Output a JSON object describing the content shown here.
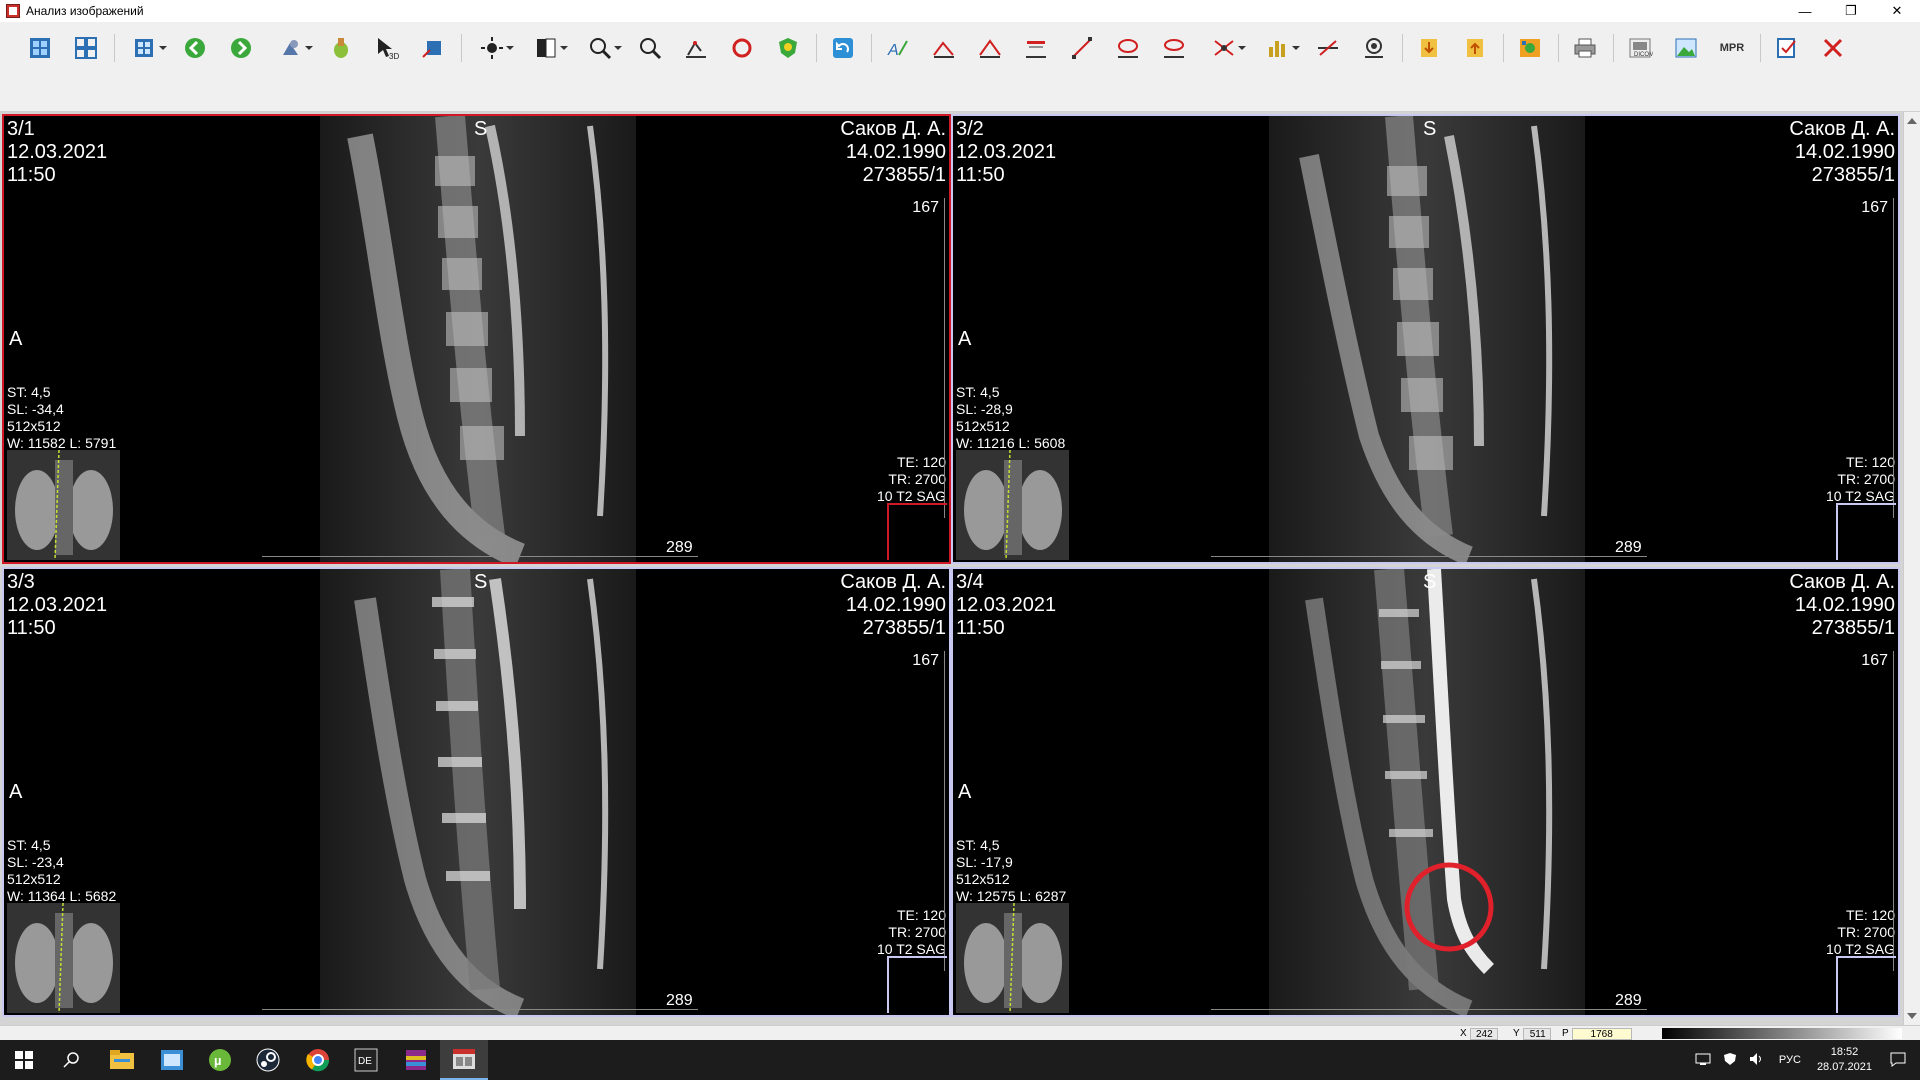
{
  "window": {
    "title": "Анализ изображений",
    "controls": [
      "minimize-icon",
      "restore-icon",
      "close-icon"
    ]
  },
  "toolbar": {
    "mpr_label": "MPR",
    "buttons": [
      "view-grid-icon",
      "layout-icon",
      "series-layout-icon",
      "back-icon",
      "forward-icon",
      "tools-icon",
      "hand-icon",
      "pointer-3d-icon",
      "sync-icon",
      "brightness-icon",
      "window-level-icon",
      "zoom-icon",
      "magnifier-icon",
      "roi-icon",
      "rotate-icon",
      "shield-icon",
      "undo-icon",
      "annotation-icon",
      "ruler-icon",
      "angle-icon",
      "cobb-icon",
      "line-icon",
      "ellipse-roi-icon",
      "profile-icon",
      "markers-icon",
      "histogram-icon",
      "cut-icon",
      "settings-eye-icon",
      "export-icon",
      "import-icon",
      "film-icon",
      "print-icon",
      "dicom-icon",
      "picture-icon",
      "mpr-button",
      "report-icon",
      "close-icon"
    ]
  },
  "panes": [
    {
      "id": "3/1",
      "date": "12.03.2021",
      "time": "11:50",
      "patient": "Саков Д. А.",
      "dob": "14.02.1990",
      "study": "273855/1",
      "scale_top": "167",
      "orient_top": "S",
      "orient_left": "A",
      "st": "ST: 4,5",
      "sl": "SL: -34,4",
      "matrix": "512x512",
      "wl": "W: 11582 L: 5791",
      "te": "TE: 120",
      "tr": "TR: 2700",
      "series": "10 T2 SAG",
      "scale_bottom": "289",
      "active": true
    },
    {
      "id": "3/2",
      "date": "12.03.2021",
      "time": "11:50",
      "patient": "Саков Д. А.",
      "dob": "14.02.1990",
      "study": "273855/1",
      "scale_top": "167",
      "orient_top": "S",
      "orient_left": "A",
      "st": "ST: 4,5",
      "sl": "SL: -28,9",
      "matrix": "512x512",
      "wl": "W: 11216 L: 5608",
      "te": "TE: 120",
      "tr": "TR: 2700",
      "series": "10 T2 SAG",
      "scale_bottom": "289",
      "active": false
    },
    {
      "id": "3/3",
      "date": "12.03.2021",
      "time": "11:50",
      "patient": "Саков Д. А.",
      "dob": "14.02.1990",
      "study": "273855/1",
      "scale_top": "167",
      "orient_top": "S",
      "orient_left": "A",
      "st": "ST: 4,5",
      "sl": "SL: -23,4",
      "matrix": "512x512",
      "wl": "W: 11364 L: 5682",
      "te": "TE: 120",
      "tr": "TR: 2700",
      "series": "10 T2 SAG",
      "scale_bottom": "289",
      "active": false
    },
    {
      "id": "3/4",
      "date": "12.03.2021",
      "time": "11:50",
      "patient": "Саков Д. А.",
      "dob": "14.02.1990",
      "study": "273855/1",
      "scale_top": "167",
      "orient_top": "S",
      "orient_left": "A",
      "st": "ST: 4,5",
      "sl": "SL: -17,9",
      "matrix": "512x512",
      "wl": "W: 12575 L: 6287",
      "te": "TE: 120",
      "tr": "TR: 2700",
      "series": "10 T2 SAG",
      "scale_bottom": "289",
      "active": false,
      "annotation": "red-circle-marker"
    }
  ],
  "statusbar": {
    "x_label": "X",
    "x_value": "242",
    "y_label": "Y",
    "y_value": "511",
    "p_label": "P",
    "p_value": "1768"
  },
  "taskbar": {
    "icons": [
      "windows-start-icon",
      "search-icon",
      "file-explorer-icon",
      "app-window-icon",
      "utorrent-icon",
      "steam-icon",
      "chrome-icon",
      "dicom-viewer-icon",
      "winrar-icon",
      "image-analysis-icon"
    ],
    "lang": "РУС",
    "time": "18:52",
    "date": "28.07.2021"
  },
  "colors": {
    "active_border": "#d01828",
    "inactive_border": "#c8c8f0",
    "annotation": "#e0202a"
  }
}
